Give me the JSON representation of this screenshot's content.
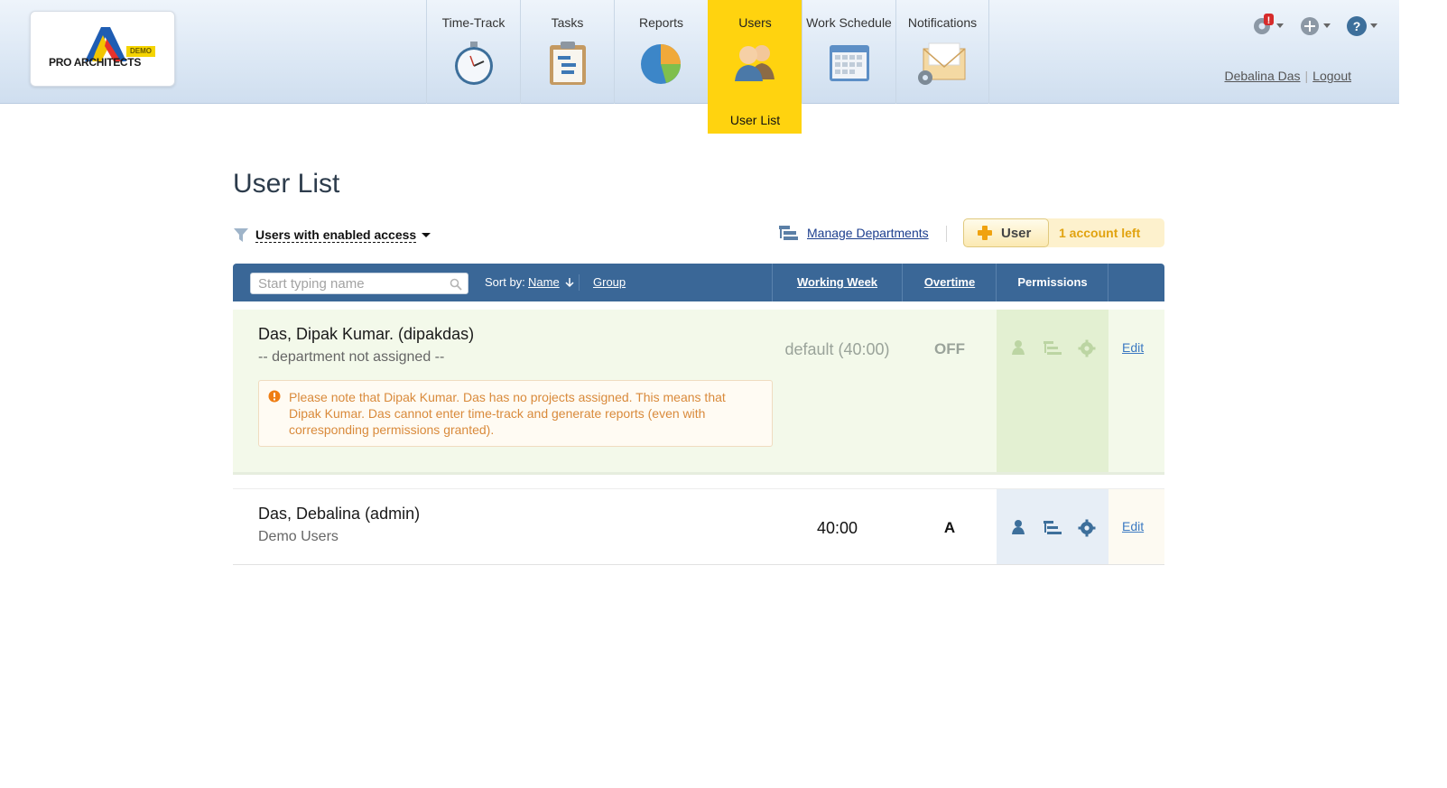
{
  "logo": {
    "text": "PRO ARCHITECTS",
    "badge": "DEMO"
  },
  "nav": [
    {
      "label": "Time-Track",
      "icon": "stopwatch-icon"
    },
    {
      "label": "Tasks",
      "icon": "clipboard-icon"
    },
    {
      "label": "Reports",
      "icon": "pie-chart-icon"
    },
    {
      "label": "Users",
      "icon": "users-icon",
      "active": true,
      "sub": "User List"
    },
    {
      "label": "Work Schedule",
      "icon": "calendar-icon"
    },
    {
      "label": "Notifications",
      "icon": "envelope-icon"
    }
  ],
  "header": {
    "user_name": "Debalina Das",
    "logout": "Logout"
  },
  "page": {
    "title": "User List"
  },
  "filter": {
    "label": "Users with enabled access"
  },
  "toolbar": {
    "manage_departments": "Manage Departments",
    "add_user": "User",
    "accounts_left": "1 account left"
  },
  "table": {
    "search_placeholder": "Start typing name",
    "sort_by_label": "Sort by:",
    "sort_name": "Name",
    "sort_group": "Group",
    "col_working_week": "Working Week",
    "col_overtime": "Overtime",
    "col_permissions": "Permissions",
    "rows": [
      {
        "name": "Das, Dipak Kumar. (dipakdas)",
        "department": "-- department not assigned --",
        "working_week": "default (40:00)",
        "overtime": "OFF",
        "warning": "Please note that Dipak Kumar. Das has no projects assigned. This means that Dipak Kumar. Das cannot enter time-track and generate reports (even with corresponding permissions granted).",
        "edit": "Edit"
      },
      {
        "name": "Das, Debalina (admin)",
        "department": "Demo Users",
        "working_week": "40:00",
        "overtime": "A",
        "edit": "Edit"
      }
    ]
  },
  "colors": {
    "accent_yellow": "#ffd30f",
    "table_header": "#3a6797",
    "link_blue": "#3b79c2",
    "warning_orange": "#d98a3b",
    "accounts_left": "#e1a310"
  }
}
